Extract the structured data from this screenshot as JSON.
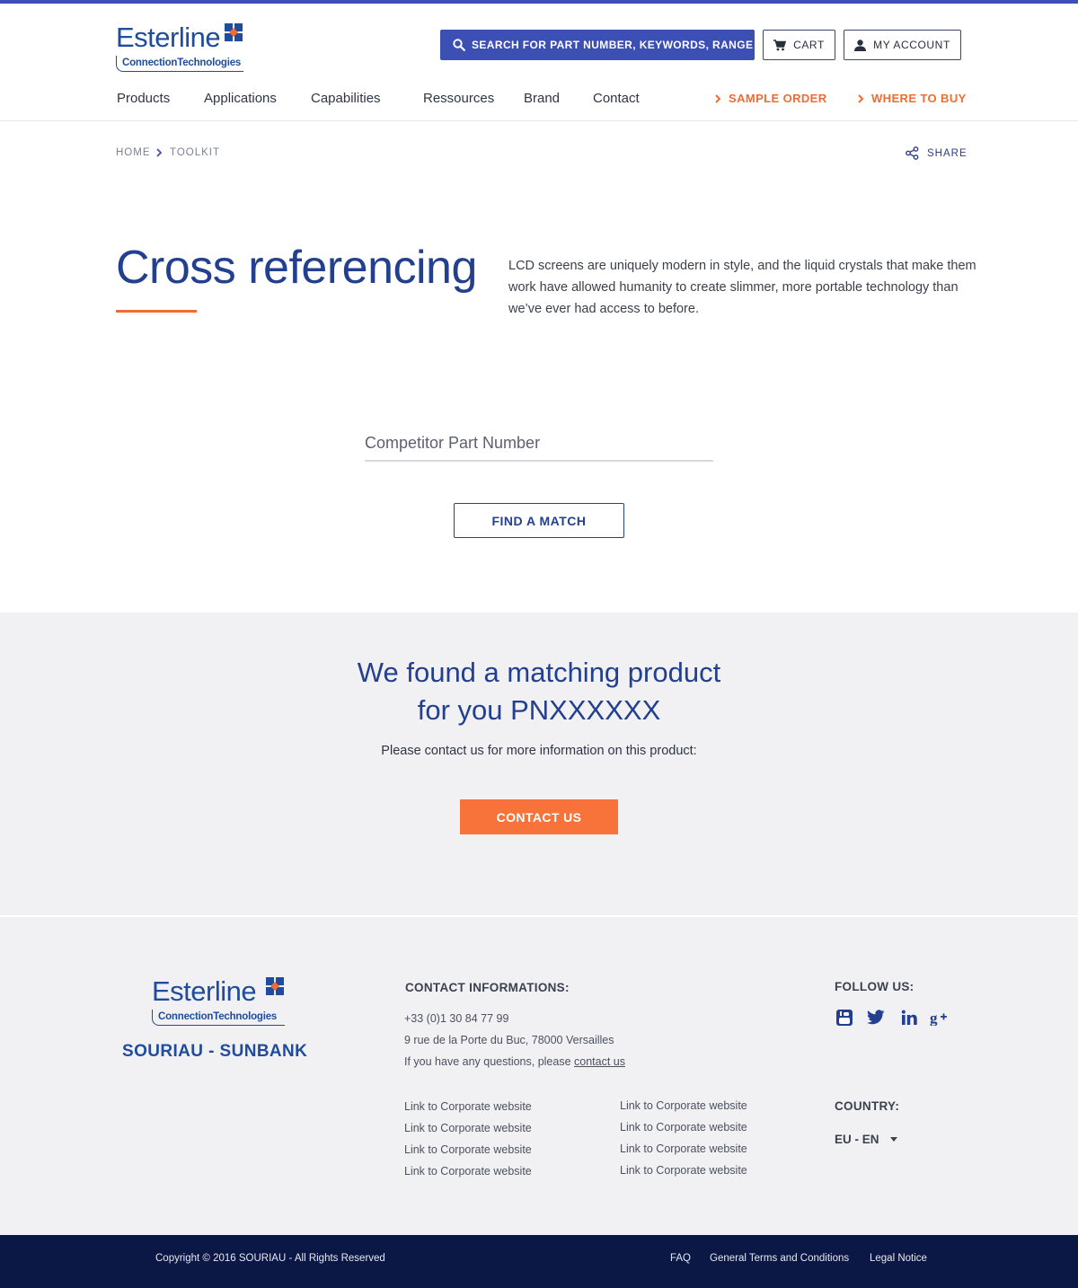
{
  "brand": {
    "logo_word": "Esterline",
    "logo_sub": "ConnectionTechnologies",
    "colors": {
      "primary": "#22408f",
      "accent": "#f26c32",
      "button_blue": "#3c4fb3",
      "footer_dark": "#0b1744"
    }
  },
  "header": {
    "search_label": "SEARCH FOR PART NUMBER, KEYWORDS, RANGE",
    "search_icon": "search-icon",
    "cart_label": "CART",
    "account_label": "MY ACCOUNT"
  },
  "nav": {
    "items": [
      "Products",
      "Applications",
      "Capabilities",
      "Ressources",
      "Brand",
      "Contact"
    ],
    "sample_order": "SAMPLE ORDER",
    "where_to_buy": "WHERE TO BUY"
  },
  "breadcrumb": {
    "home": "HOME",
    "current": "TOOLKIT",
    "share": "SHARE"
  },
  "hero": {
    "title": "Cross referencing",
    "intro": "LCD screens are uniquely modern in style, and the liquid crystals that make them work have allowed humanity to create slimmer, more portable technology than we’ve ever had access to before.",
    "input_placeholder": "Competitor Part Number",
    "find_button": "FIND A MATCH"
  },
  "result": {
    "title_line1": "We found a matching product",
    "title_line2": "for you PNXXXXXX",
    "subtitle": "Please contact us for more information on this product:",
    "contact_button": "CONTACT US"
  },
  "footer": {
    "logo_word": "Esterline",
    "logo_sub": "ConnectionTechnologies",
    "brand2": "SOURIAU - SUNBANK",
    "contact_heading": "CONTACT INFORMATIONS:",
    "phone": "+33 (0)1 30 84 77 99",
    "address": "9 rue de la Porte du Buc, 78000 Versailles",
    "questions_text": "If you have any questions, please",
    "contact_link": "contact us",
    "links_col1": [
      "Link to Corporate website",
      "Link to Corporate website",
      "Link to Corporate website",
      "Link to Corporate website"
    ],
    "links_col2": [
      "Link to Corporate website",
      "Link to Corporate website",
      "Link to Corporate website",
      "Link to Corporate website"
    ],
    "follow_heading": "FOLLOW US:",
    "social_icons": [
      "youtube-icon",
      "twitter-icon",
      "linkedin-icon",
      "googleplus-icon"
    ],
    "country_heading": "COUNTRY:",
    "country_value": "EU - EN"
  },
  "bottom": {
    "copyright": "Copyright © 2016 SOURIAU - All Rights Reserved",
    "faq": "FAQ",
    "terms": "General Terms and Conditions",
    "legal": "Legal Notice"
  }
}
